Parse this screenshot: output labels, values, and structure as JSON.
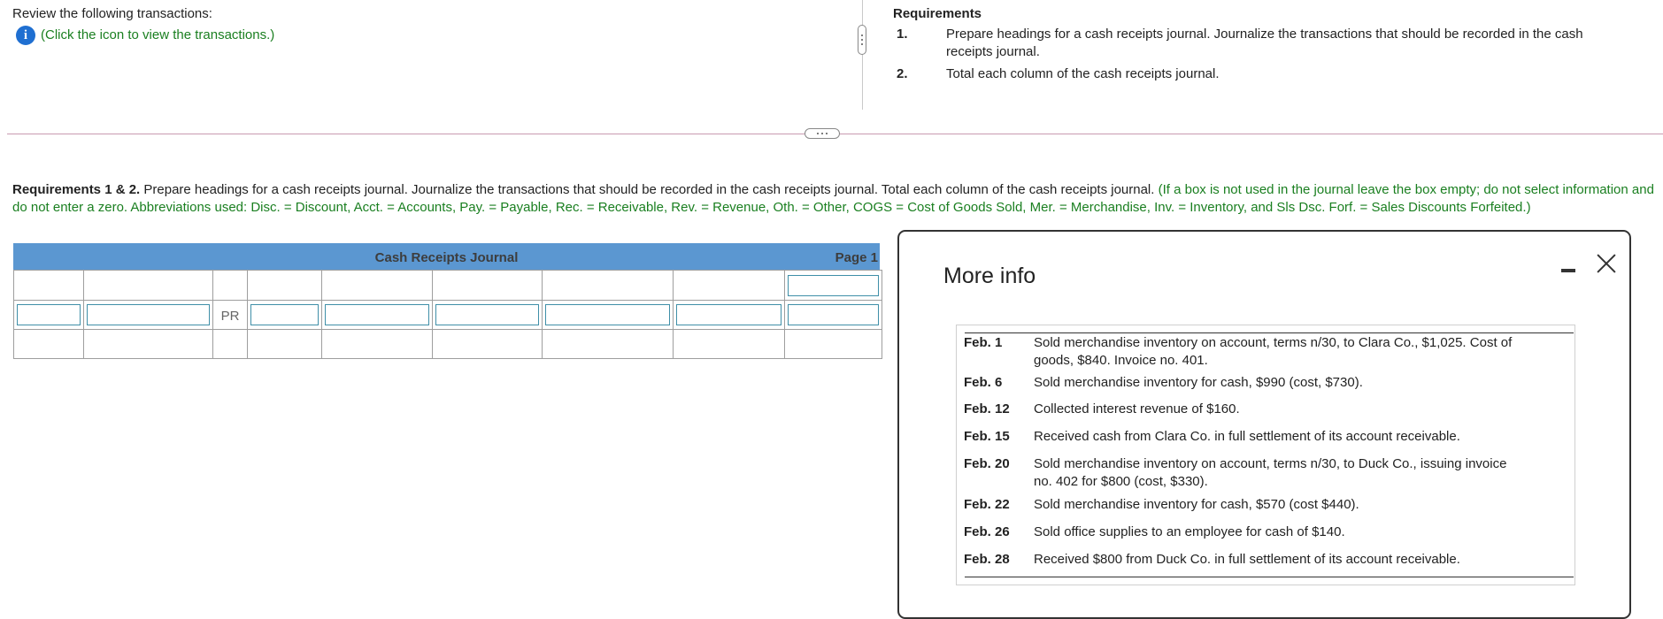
{
  "top_left": {
    "review_text": "Review the following transactions:",
    "info_icon_glyph": "i",
    "info_link": "(Click the icon to view the transactions.)"
  },
  "requirements": {
    "heading": "Requirements",
    "items": [
      {
        "num": "1.",
        "line1": "Prepare headings for a cash receipts journal. Journalize the transactions that should be recorded in the cash",
        "line2": "receipts journal."
      },
      {
        "num": "2.",
        "line1": "Total each column of the cash receipts journal."
      }
    ]
  },
  "instructions": {
    "bold": "Requirements 1 & 2.",
    "body": " Prepare headings for a cash receipts journal. Journalize the transactions that should be recorded in the cash receipts journal. Total each column of the cash receipts journal.",
    "green": " (If a box is not used in the journal leave the box empty; do not select information and do not enter a zero. Abbreviations used: Disc. = Discount, Acct. = Accounts, Pay. = Payable, Rec. = Receivable, Rev. = Revenue, Oth. = Other, COGS = Cost of Goods Sold, Mer. = Merchandise, Inv. = Inventory, and Sls Dsc. Forf. = Sales Discounts Forfeited.)"
  },
  "journal": {
    "title": "Cash Receipts Journal",
    "page": "Page 1",
    "pr_label": "PR"
  },
  "modal": {
    "title": "More info",
    "transactions": [
      {
        "date": "Feb. 1",
        "line1": "Sold merchandise inventory on account, terms n/30, to Clara Co., $1,025. Cost of",
        "line2": "goods, $840. Invoice no. 401."
      },
      {
        "date": "Feb. 6",
        "line1": "Sold merchandise inventory for cash, $990 (cost, $730)."
      },
      {
        "date": "Feb. 12",
        "line1": "Collected interest revenue of $160."
      },
      {
        "date": "Feb. 15",
        "line1": "Received cash from Clara Co. in full settlement of its account receivable."
      },
      {
        "date": "Feb. 20",
        "line1": "Sold merchandise inventory on account, terms n/30, to Duck Co., issuing invoice",
        "line2": "no. 402 for $800 (cost, $330)."
      },
      {
        "date": "Feb. 22",
        "line1": "Sold merchandise inventory for cash, $570 (cost $440)."
      },
      {
        "date": "Feb. 26",
        "line1": "Sold office supplies to an employee for cash of $140."
      },
      {
        "date": "Feb. 28",
        "line1": "Received $800 from Duck Co. in full settlement of its account receivable."
      }
    ]
  },
  "colors": {
    "accent_green": "#1a7f20",
    "journal_header": "#5b97d1",
    "info_icon": "#1f6fd1",
    "input_border": "#3f8fa8"
  }
}
